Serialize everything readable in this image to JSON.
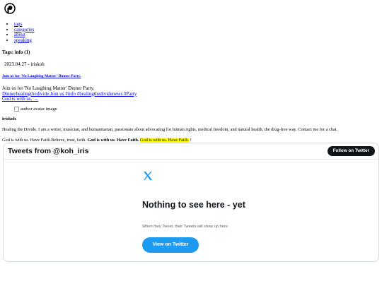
{
  "nav": {
    "items": [
      "tags",
      "categories",
      "about",
      "speaking"
    ]
  },
  "page": {
    "heading": "Tags: info (1)"
  },
  "post": {
    "meta": "2023.04.27 - iriskoh",
    "title": "Join us for 'No Laughing Matter' Dinner Party.",
    "excerpt": "Join us for 'No Laughing Matter' Dinner Party.",
    "tags_link": "Dinnerhealingthedivide.Join us #info #healingthedividenews #Party",
    "more_link": "God is with us. →"
  },
  "author": {
    "avatar_alt": "author avatar image",
    "name": "iriskoh",
    "bio": "Healing the Divide. I am a writer, musician, and humanitarian, passionate about advocating for human rights, medical freedom, and natural health, the drug-free way. Contact me for a chat.",
    "motto_start": "God is with us. Have Faith.Believe, trust, faith.",
    "motto_bold": "God is with us. Have Faith.",
    "motto_highlight": "God is with us. Have Faith.",
    "motto_end": "!"
  },
  "twitter": {
    "title": "Tweets from @koh_iris",
    "follow_label": "Follow on Twitter",
    "empty_title": "Nothing to see here - yet",
    "empty_sub": "When they Tweet, their Tweets will show up here.",
    "view_label": "View on Twitter",
    "accent": "#1d9bf0"
  },
  "icons": [
    "site-logo-icon",
    "x-logo-icon",
    "broken-image-icon"
  ]
}
